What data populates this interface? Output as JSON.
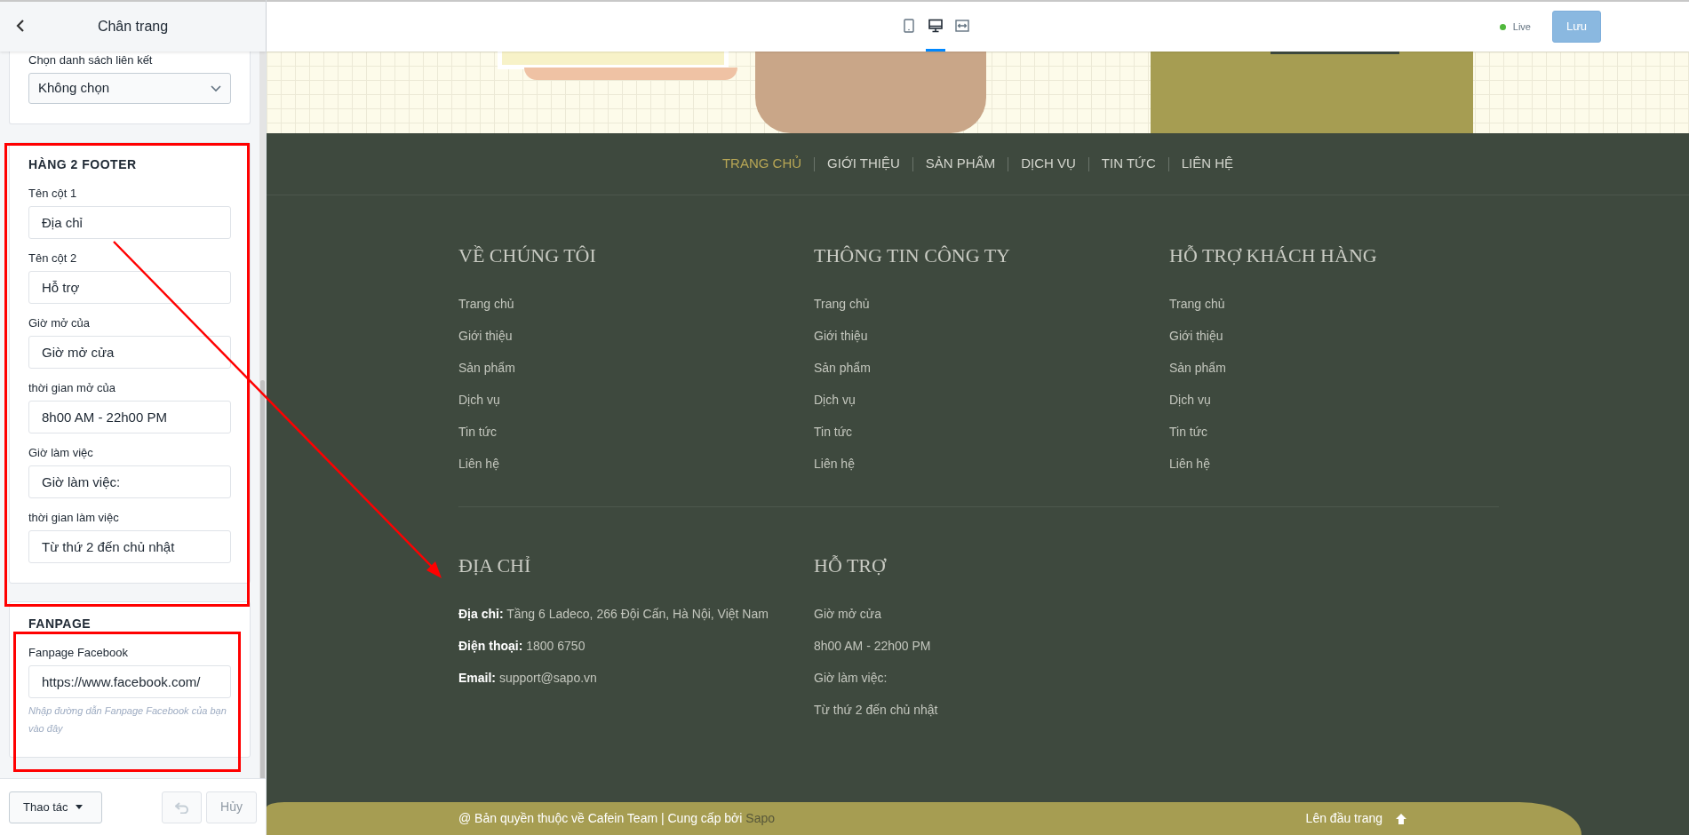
{
  "sidebar": {
    "title": "Chân trang",
    "sections": [
      {
        "fields": [
          {
            "kind": "select",
            "label": "Chọn danh sách liên kết",
            "value": "Không chọn"
          }
        ]
      },
      {
        "heading": "HÀNG 2 FOOTER",
        "fields": [
          {
            "kind": "text",
            "label": "Tên cột 1",
            "value": "Địa chỉ"
          },
          {
            "kind": "text",
            "label": "Tên cột 2",
            "value": "Hỗ trợ"
          },
          {
            "kind": "text",
            "label": "Giờ mở của",
            "value": "Giờ mở cửa"
          },
          {
            "kind": "text",
            "label": "thời gian mở của",
            "value": "8h00 AM - 22h00 PM"
          },
          {
            "kind": "text",
            "label": "Giờ làm việc",
            "value": "Giờ làm việc:"
          },
          {
            "kind": "text",
            "label": "thời gian làm việc",
            "value": "Từ thứ 2 đến chủ nhật"
          }
        ]
      },
      {
        "heading": "FANPAGE",
        "fields": [
          {
            "kind": "text",
            "label": "Fanpage Facebook",
            "value": "https://www.facebook.com/",
            "help": "Nhập đường dẫn Fanpage Facebook của bạn vào đây"
          }
        ]
      }
    ],
    "actions": {
      "menu_button": "Thao tác",
      "undo_disabled": true,
      "cancel": {
        "label": "Hủy",
        "disabled": true
      }
    }
  },
  "toolbar": {
    "views": [
      {
        "kind": "mobile",
        "selected": false
      },
      {
        "kind": "desktop",
        "selected": true
      },
      {
        "kind": "fullwidth",
        "selected": false
      }
    ],
    "status": "Live",
    "save": {
      "label": "Lưu",
      "disabled": true
    }
  },
  "footer": {
    "nav": [
      {
        "label": "TRANG CHỦ",
        "selected": true
      },
      {
        "label": "GIỚI THIỆU",
        "selected": false
      },
      {
        "label": "SẢN PHẨM",
        "selected": false
      },
      {
        "label": "DỊCH VỤ",
        "selected": false
      },
      {
        "label": "TIN TỨC",
        "selected": false
      },
      {
        "label": "LIÊN HỆ",
        "selected": false
      }
    ],
    "columns": [
      {
        "title": "VỀ CHÚNG TÔI",
        "links": [
          "Trang chủ",
          "Giới thiệu",
          "Sản phẩm",
          "Dịch vụ",
          "Tin tức",
          "Liên hệ"
        ]
      },
      {
        "title": "THÔNG TIN CÔNG TY",
        "links": [
          "Trang chủ",
          "Giới thiệu",
          "Sản phẩm",
          "Dịch vụ",
          "Tin tức",
          "Liên hệ"
        ]
      },
      {
        "title": "HỖ TRỢ KHÁCH HÀNG",
        "links": [
          "Trang chủ",
          "Giới thiệu",
          "Sản phẩm",
          "Dịch vụ",
          "Tin tức",
          "Liên hệ"
        ]
      }
    ],
    "contact": {
      "title": "ĐỊA CHỈ",
      "items": [
        {
          "label": "Địa chỉ:",
          "value": "Tầng 6 Ladeco, 266 Đội Cấn, Hà Nội, Việt Nam"
        },
        {
          "label": "Điện thoại:",
          "value": "1800 6750"
        },
        {
          "label": "Email:",
          "value": "support@sapo.vn"
        }
      ]
    },
    "support": {
      "title": "HỖ TRỢ",
      "lines": [
        "Giờ mở cửa",
        "8h00 AM - 22h00 PM",
        "Giờ làm việc:",
        "Từ thứ 2 đến chủ nhật"
      ]
    },
    "copyright": "@ Bản quyền thuộc về Cafein Team | Cung cấp bởi",
    "copyright_link": "Sapo",
    "back_to_top": "Lên đầu trang"
  }
}
